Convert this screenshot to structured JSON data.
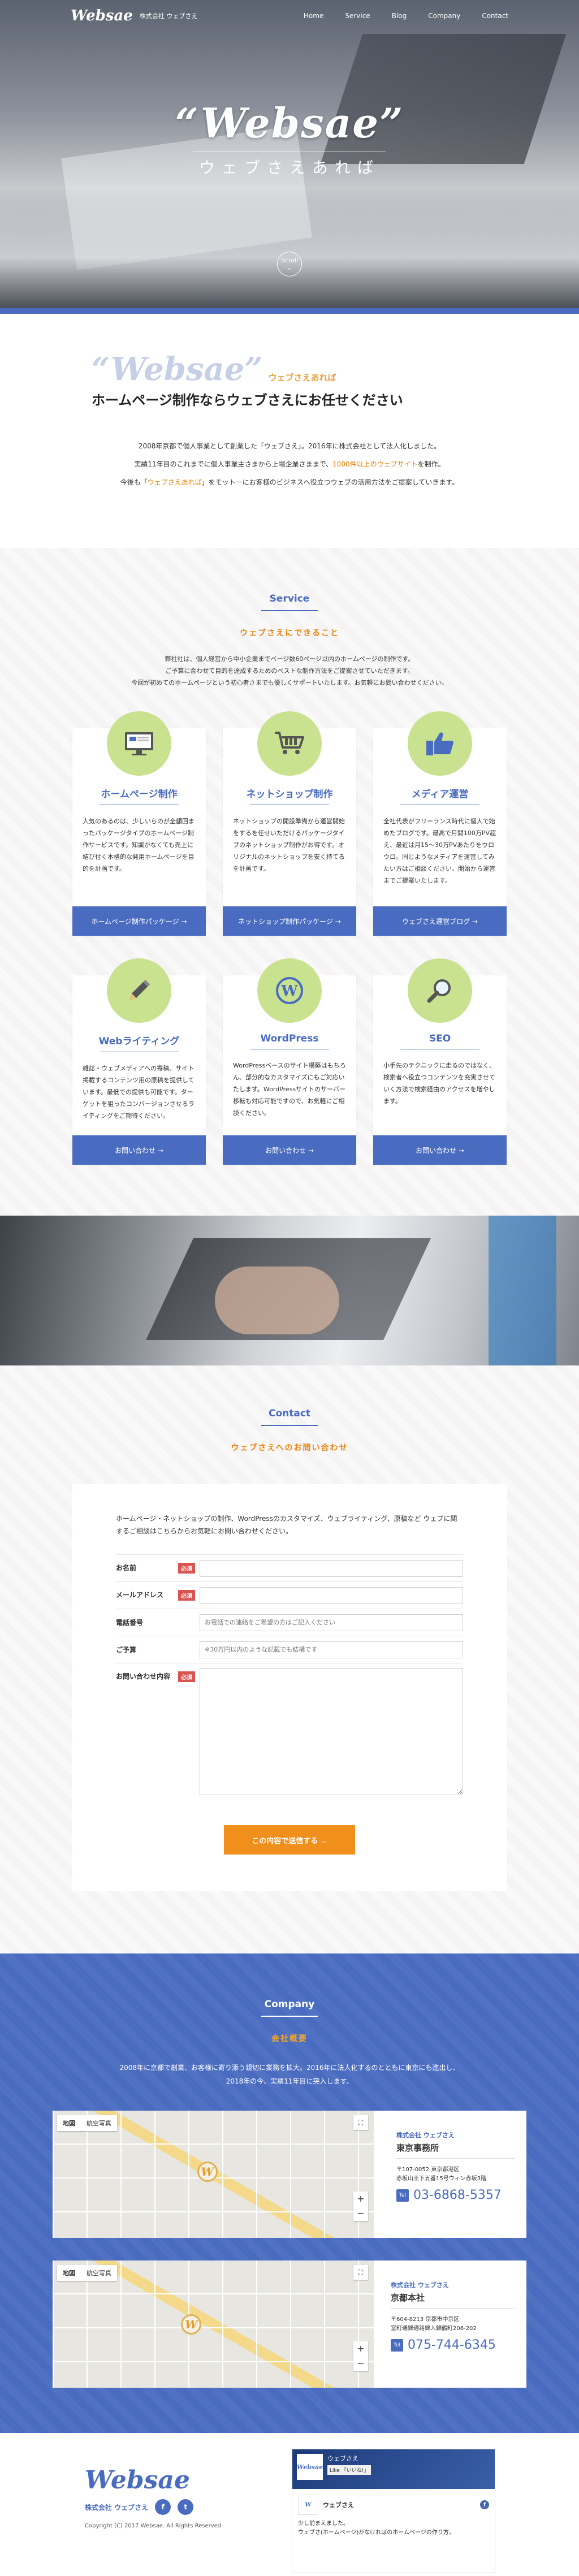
{
  "header": {
    "logo": "Websae",
    "company": "株式会社 ウェブさえ",
    "nav": [
      "Home",
      "Service",
      "Blog",
      "Company",
      "Contact"
    ]
  },
  "hero": {
    "title": "“Websae”",
    "kana": "ウェブさえあれば",
    "scroll": "Scroll"
  },
  "intro": {
    "logo": "“Websae”",
    "kana": "ウェブさえあれば",
    "heading": "ホームページ制作ならウェブさえにお任せください",
    "p1": "2008年京都で個人事業として創業した「ウェブさえ」。2016年に株式会社として法人化しました。",
    "p2a": "実績11年目のこれまでに個人事業主さまから上場企業さままで、",
    "p2b": "1000件以上のウェブサイト",
    "p2c": "を制作。",
    "p3a": "今後も「",
    "p3b": "ウェブさえあれば",
    "p3c": "」をモットーにお客様のビジネスへ役立つウェブの活用方法をご提案していきます。"
  },
  "service": {
    "title": "Service",
    "sub": "ウェブさえにできること",
    "p1": "弊社社は、個人経営から中小企業までページ数60ページ以内のホームページの制作です。",
    "p2": "ご予算に合わせて目的を達成するためのベストな制作方法をご提案させていただきます。",
    "p3": "今回が初めてのホームページという初心者さまでも優しくサポートいたします。お気軽にお問い合わせください。",
    "cards": [
      {
        "title": "ホームページ制作",
        "text": "人気のあるのは、少しいらのが全額回まったパッケージタイプのホームページ制作サービスです。知識がなくても売上に結び付く本格的な発用ホームページを目的を計画です。",
        "btn": "ホームページ制作パッケージ →",
        "icon": "monitor-icon"
      },
      {
        "title": "ネットショップ制作",
        "text": "ネットショップの開設準備から運営開始をするを任せいただけるパッケージタイプのネットショップ制作がお得です。オリジナルのネットショップを安く持てるを計画です。",
        "btn": "ネットショップ制作パッケージ →",
        "icon": "cart-icon"
      },
      {
        "title": "メディア運営",
        "text": "全社代表がフリーランス時代に個人で始めたブログです。最高で月間100万PV超え、最近は月15〜30万PVあたりをウロウロ。同じようなメディアを運営してみたい方はご相談ください。開始から運営までご提案いたします。",
        "btn": "ウェブさえ運営ブログ →",
        "icon": "thumbs-up-icon"
      },
      {
        "title": "Webライティング",
        "text": "雑誌・ウェブメディアへの寄稿、サイト掲載するコンテンツ用の原稿を提供しています。最低での提供も可能です。ターゲットを狙ったコンバージョンさせるライティングをご期待ください。",
        "btn": "お問い合わせ →",
        "icon": "pencil-icon"
      },
      {
        "title": "WordPress",
        "text": "WordPressベースのサイト構築はもちろん、部分的なカスタマイズにもご対応いたします。WordPressサイトのサーバー移転も対応可能ですので、お気軽にご相談ください。",
        "btn": "お問い合わせ →",
        "icon": "wordpress-icon"
      },
      {
        "title": "SEO",
        "text": "小手先のテクニックに走るのではなく、検索者へ役立つコンテンツを充実させていく方法で検索経由のアクセスを増やします。",
        "btn": "お問い合わせ →",
        "icon": "magnifier-icon"
      }
    ]
  },
  "contact": {
    "title": "Contact",
    "sub": "ウェブさえへのお問い合わせ",
    "intro": "ホームページ・ネットショップの制作、WordPressのカスタマイズ、ウェブライティング、原稿など ウェブに関するご相談はこちらからお気軽にお問い合わせください。",
    "required": "必須",
    "fields": [
      {
        "label": "お名前",
        "required": true,
        "placeholder": ""
      },
      {
        "label": "メールアドレス",
        "required": true,
        "placeholder": ""
      },
      {
        "label": "電話番号",
        "required": false,
        "placeholder": "お電話での連絡をご希望の方はご記入ください"
      },
      {
        "label": "ご予算",
        "required": false,
        "placeholder": "※30万円以内のような記載でも結構です"
      },
      {
        "label": "お問い合わせ内容",
        "required": true,
        "placeholder": ""
      }
    ],
    "submit": "この内容で送信する →"
  },
  "company": {
    "title": "Company",
    "sub": "会社概要",
    "p1": "2008年に京都で創業、お客様に寄り添う親切に業務を拡大。2016年に法人化するのとともに東京にも進出し、",
    "p2": "2018年の今、実績11年目に突入します。",
    "map_tabs": [
      "地図",
      "航空写真"
    ],
    "offices": [
      {
        "co": "株式会社 ウェブさえ",
        "name": "東京事務所",
        "addr1": "〒107-0052 東京都港区",
        "addr2": "赤坂山王下五番15号ウィン赤坂3階",
        "tel_label": "Tel",
        "tel": "03-6868-5357"
      },
      {
        "co": "株式会社 ウェブさえ",
        "name": "京都本社",
        "addr1": "〒604-8213 京都市中京区",
        "addr2": "室町通錦通路錦入錦鶴町208-202",
        "tel_label": "Tel",
        "tel": "075-744-6345"
      }
    ]
  },
  "footer": {
    "logo": "Websae",
    "company": "株式会社 ウェブさえ",
    "copyright": "Copyright (C) 2017 Websae. All Rights Reserved.",
    "fb": {
      "page": "ウェブさえ",
      "likes": "Like 「いいね!」",
      "post_name": "ウェブさえ",
      "line1": "少し前まえました。",
      "line2": "ウェブさ(ホームページ)がなければのホームページの作り方。"
    }
  },
  "colors": {
    "brand": "#4a6cc0",
    "accent": "#e8830d",
    "button": "#f18f1c",
    "icon_bg": "#c9e28f"
  }
}
